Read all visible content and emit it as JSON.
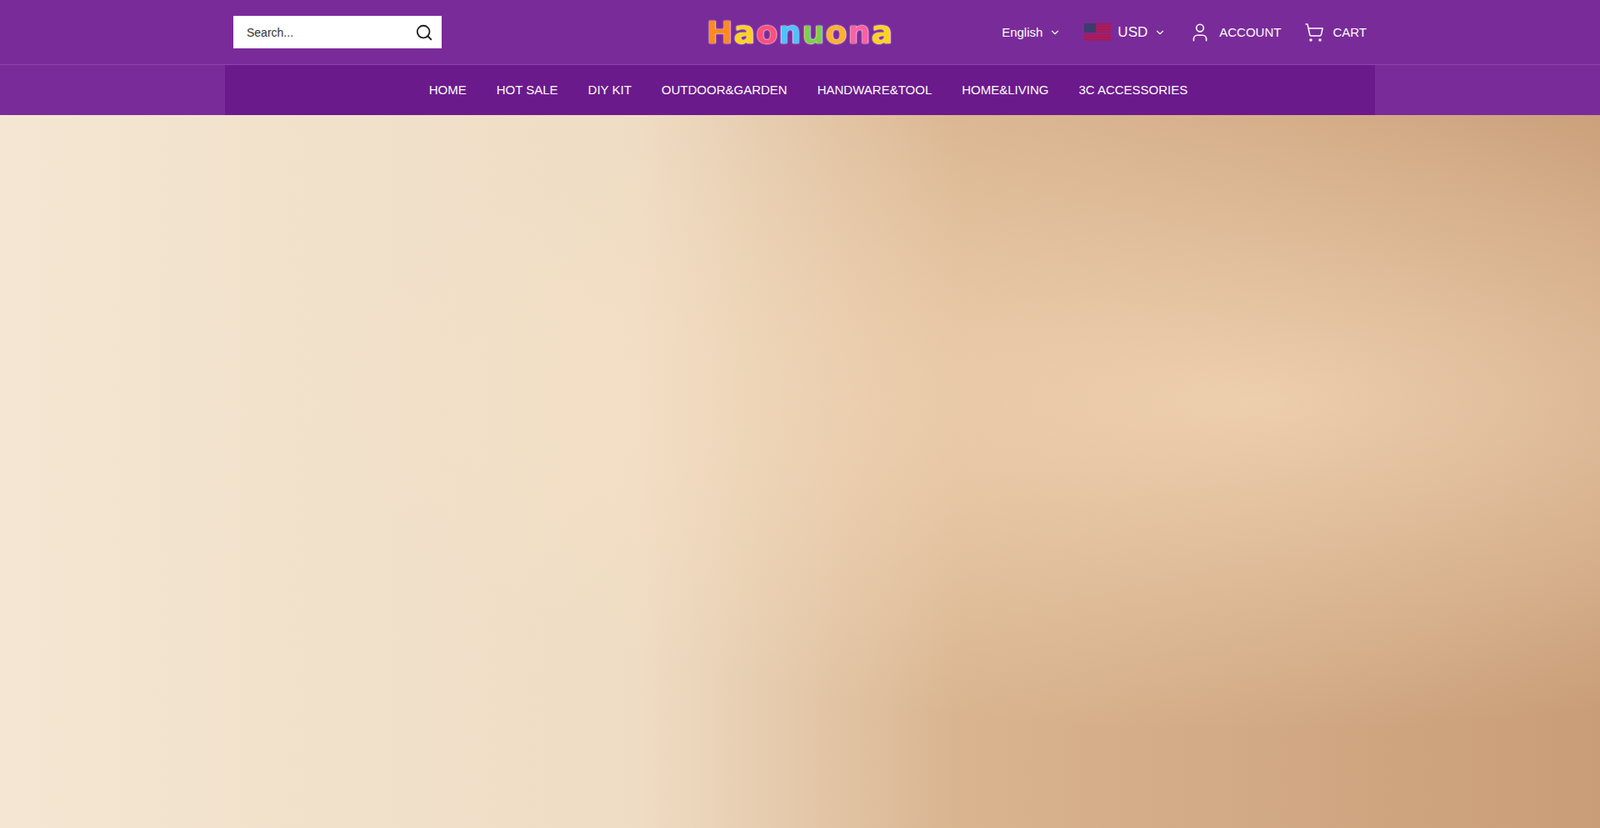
{
  "header": {
    "search": {
      "placeholder": "Search..."
    },
    "logo": "Haonuona",
    "language": "English",
    "currency": "USD",
    "account": "ACCOUNT",
    "cart": "CART"
  },
  "nav": {
    "items": [
      {
        "label": "HOME",
        "selected": false
      },
      {
        "label": "HOT SALE",
        "selected": false
      },
      {
        "label": "DIY KIT",
        "selected": false
      },
      {
        "label": "OUTDOOR&GARDEN",
        "selected": false
      },
      {
        "label": "HANDWARE&TOOL",
        "selected": false
      },
      {
        "label": "HOME&LIVING",
        "selected": false
      },
      {
        "label": "3C ACCESSORIES",
        "selected": false
      }
    ]
  },
  "hero": {
    "kind": "photo"
  }
}
